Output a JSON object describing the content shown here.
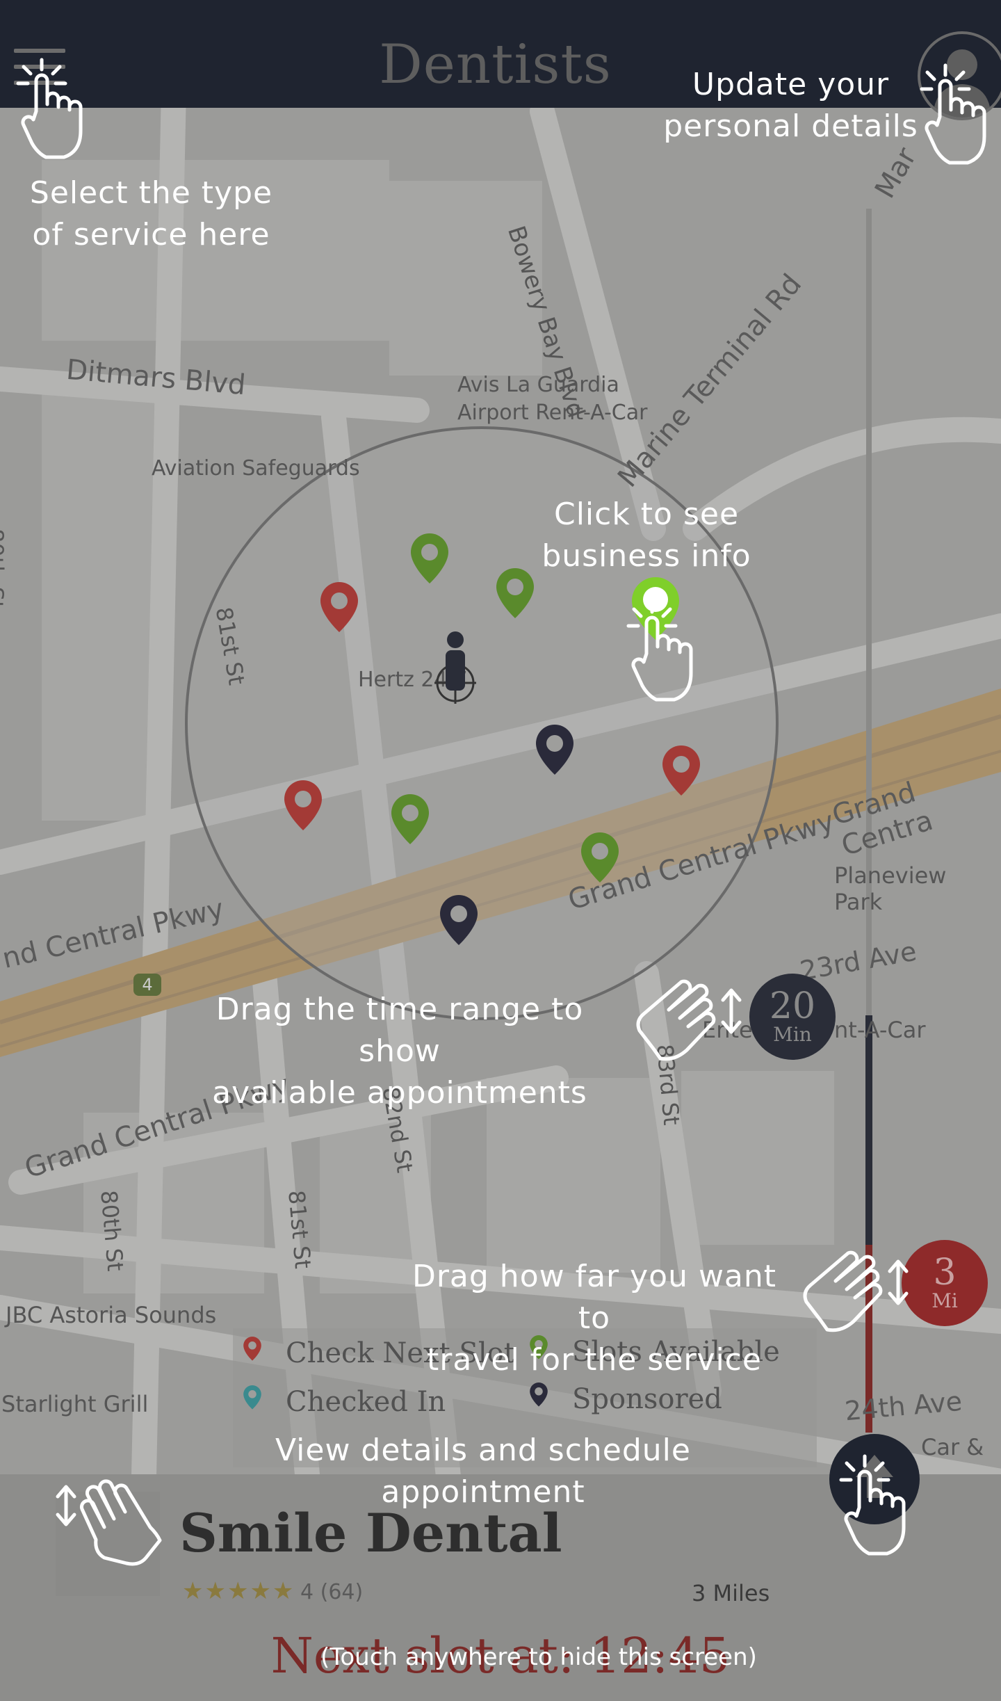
{
  "header": {
    "title": "Dentists"
  },
  "map": {
    "streets": [
      "Bowery Bay Blvd",
      "Ditmars Blvd",
      "Marine Terminal Rd",
      "Avis La Guardia",
      "Airport Rent-A-Car",
      "Aviation Safeguards",
      "80th St",
      "81st St",
      "Hertz 24/7",
      "Grand Central Pkwy",
      "nd Central Pkwy",
      "Grand Centra",
      "Planeview Park",
      "23rd Ave",
      "nt-A-Car",
      "Ente",
      "82nd St",
      "83rd St",
      "81st St",
      "80th St",
      "JBC Astoria Sounds",
      "Starlight Grill",
      "24th Ave",
      "Car &",
      "Mar",
      "4"
    ]
  },
  "time_slider": {
    "value": "20",
    "unit": "Min"
  },
  "distance_slider": {
    "value": "3",
    "unit": "Mi"
  },
  "legend": {
    "items": [
      {
        "label": "Check Next Slot",
        "color": "#a33a36"
      },
      {
        "label": "Slots Available",
        "color": "#5a8a2c"
      },
      {
        "label": "Checked In",
        "color": "#3a8a8e"
      },
      {
        "label": "Sponsored",
        "color": "#2a2a3a"
      }
    ]
  },
  "business": {
    "name": "Smile Dental",
    "stars": "★★★★★",
    "rating": "4 (64)",
    "distance": "3 Miles",
    "next_slot": "Next slot at: 12:45"
  },
  "hints": {
    "service_line1": "Select the type",
    "service_line2": "of service here",
    "profile_line1": "Update your",
    "profile_line2": "personal details",
    "business_line1": "Click to see",
    "business_line2": "business info",
    "time_line1": "Drag the time range to show",
    "time_line2": "available appointments",
    "distance_line1": "Drag how far you want to",
    "distance_line2": "travel for the service",
    "details_line1": "View details and schedule",
    "details_line2": "appointment",
    "dismiss": "(Touch anywhere to hide this screen)"
  },
  "colors": {
    "topbar": "#1f2430",
    "pin_red": "#a33a36",
    "pin_green": "#5a8a2c",
    "pin_dark": "#2a2a3a",
    "pin_highlight": "#7fcf2a",
    "distance_badge": "#8e2a2a"
  }
}
